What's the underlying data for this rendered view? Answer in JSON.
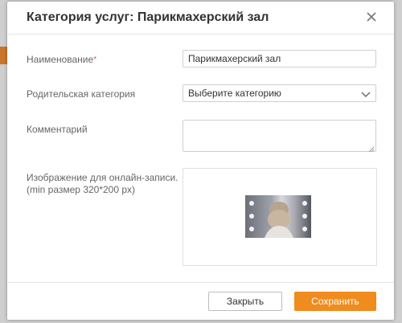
{
  "modal": {
    "title": "Категория услуг: Парикмахерский зал",
    "close_icon": "close-icon"
  },
  "form": {
    "name_label": "Наименование",
    "required_mark": "*",
    "name_value": "Парикмахерский зал",
    "parent_label": "Родительская категория",
    "parent_value": "Выберите категорию",
    "comment_label": "Комментарий",
    "comment_value": "",
    "image_label_line1": "Изображение для онлайн-записи.",
    "image_label_line2": "(min размер 320*200 px)"
  },
  "footer": {
    "close_label": "Закрыть",
    "save_label": "Сохранить"
  },
  "colors": {
    "accent": "#f08c1d",
    "required": "#d9534f"
  }
}
